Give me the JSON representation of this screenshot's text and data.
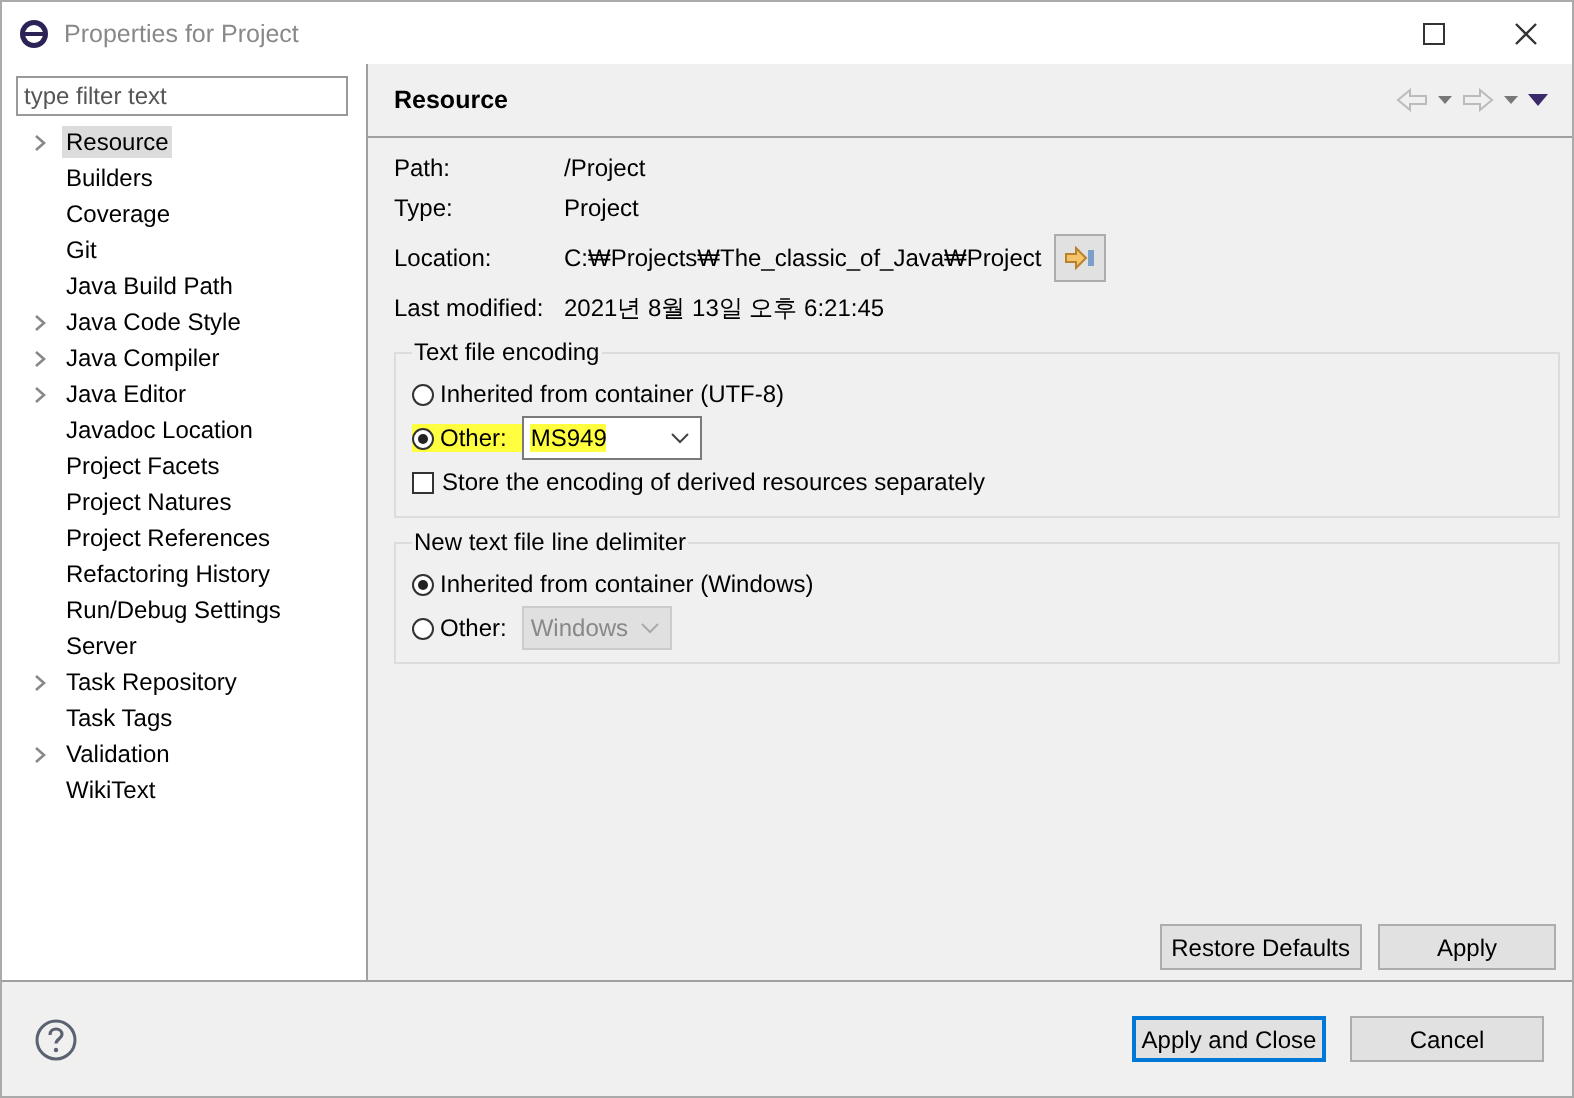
{
  "window": {
    "title": "Properties for Project"
  },
  "filter": {
    "placeholder": "type filter text"
  },
  "tree": [
    {
      "label": "Resource",
      "expandable": true,
      "selected": true
    },
    {
      "label": "Builders",
      "expandable": false,
      "selected": false
    },
    {
      "label": "Coverage",
      "expandable": false,
      "selected": false
    },
    {
      "label": "Git",
      "expandable": false,
      "selected": false
    },
    {
      "label": "Java Build Path",
      "expandable": false,
      "selected": false
    },
    {
      "label": "Java Code Style",
      "expandable": true,
      "selected": false
    },
    {
      "label": "Java Compiler",
      "expandable": true,
      "selected": false
    },
    {
      "label": "Java Editor",
      "expandable": true,
      "selected": false
    },
    {
      "label": "Javadoc Location",
      "expandable": false,
      "selected": false
    },
    {
      "label": "Project Facets",
      "expandable": false,
      "selected": false
    },
    {
      "label": "Project Natures",
      "expandable": false,
      "selected": false
    },
    {
      "label": "Project References",
      "expandable": false,
      "selected": false
    },
    {
      "label": "Refactoring History",
      "expandable": false,
      "selected": false
    },
    {
      "label": "Run/Debug Settings",
      "expandable": false,
      "selected": false
    },
    {
      "label": "Server",
      "expandable": false,
      "selected": false
    },
    {
      "label": "Task Repository",
      "expandable": true,
      "selected": false
    },
    {
      "label": "Task Tags",
      "expandable": false,
      "selected": false
    },
    {
      "label": "Validation",
      "expandable": true,
      "selected": false
    },
    {
      "label": "WikiText",
      "expandable": false,
      "selected": false
    }
  ],
  "page": {
    "title": "Resource",
    "info": [
      {
        "label": "Path:",
        "value": "/Project"
      },
      {
        "label": "Type:",
        "value": "Project"
      },
      {
        "label": "Location:",
        "value": "C:₩Projects₩The_classic_of_Java₩Project",
        "button": true
      },
      {
        "label": "Last modified:",
        "value": "2021년 8월 13일 오후 6:21:45"
      }
    ],
    "groups": [
      {
        "title": "Text file encoding",
        "options": [
          {
            "kind": "radio",
            "label": "Inherited from container (UTF-8)",
            "selected": false,
            "highlighted": false
          },
          {
            "kind": "radio",
            "label": "Other:",
            "selected": true,
            "highlighted": true,
            "combo": {
              "value": "MS949",
              "disabled": false
            }
          },
          {
            "kind": "checkbox",
            "label": "Store the encoding of derived resources separately",
            "checked": false
          }
        ]
      },
      {
        "title": "New text file line delimiter",
        "options": [
          {
            "kind": "radio",
            "label": "Inherited from container (Windows)",
            "selected": true,
            "highlighted": false
          },
          {
            "kind": "radio",
            "label": "Other:",
            "selected": false,
            "highlighted": false,
            "combo": {
              "value": "Windows",
              "disabled": true
            }
          }
        ]
      }
    ],
    "buttons": [
      "Restore Defaults",
      "Apply"
    ]
  },
  "footer": {
    "buttons": [
      {
        "label": "Apply and Close",
        "default": true
      },
      {
        "label": "Cancel",
        "default": false
      }
    ]
  }
}
